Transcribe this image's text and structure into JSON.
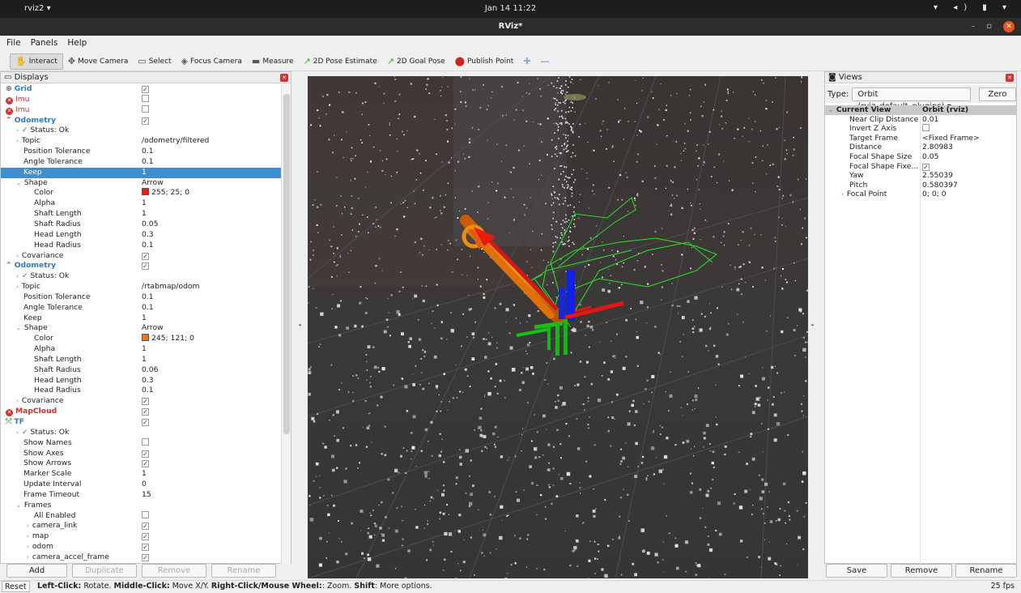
{
  "system_bar": {
    "app_label": "rviz2 ▾",
    "clock": "Jan 14  11:22",
    "tray": "▾ ◂) ▮ ▾"
  },
  "window": {
    "title": "RViz*"
  },
  "menu": [
    "File",
    "Panels",
    "Help"
  ],
  "toolbar": [
    {
      "label": "Interact",
      "icon": "✋",
      "active": true
    },
    {
      "label": "Move Camera",
      "icon": "✥"
    },
    {
      "label": "Select",
      "icon": "▭"
    },
    {
      "label": "Focus Camera",
      "icon": "◈"
    },
    {
      "label": "Measure",
      "icon": "▬"
    },
    {
      "label": "2D Pose Estimate",
      "icon": "↗"
    },
    {
      "label": "2D Goal Pose",
      "icon": "↗"
    },
    {
      "label": "Publish Point",
      "icon": "⬤"
    },
    {
      "label": "",
      "icon": "✛"
    },
    {
      "label": "",
      "icon": "—"
    }
  ],
  "displays": {
    "title": "Displays",
    "rows": [
      {
        "d": 0,
        "icon": "grid",
        "name": "Grid",
        "val": "",
        "chk": true,
        "style": "blue bold"
      },
      {
        "d": 0,
        "icon": "err",
        "name": "Imu",
        "val": "",
        "chk": false,
        "style": "red"
      },
      {
        "d": 0,
        "icon": "err",
        "name": "Imu",
        "val": "",
        "chk": false,
        "style": "red"
      },
      {
        "d": 0,
        "icon": "odom",
        "name": "Odometry",
        "val": "",
        "chk": true,
        "style": "blue bold"
      },
      {
        "d": 1,
        "arrow": "›",
        "ok": true,
        "name": "Status: Ok",
        "val": ""
      },
      {
        "d": 1,
        "arrow": "›",
        "name": "Topic",
        "val": "/odometry/filtered"
      },
      {
        "d": 1,
        "name": "Position Tolerance",
        "val": "0.1"
      },
      {
        "d": 1,
        "name": "Angle Tolerance",
        "val": "0.1"
      },
      {
        "d": 1,
        "name": "Keep",
        "val": "1",
        "selected": true
      },
      {
        "d": 1,
        "arrow": "⌄",
        "name": "Shape",
        "val": "Arrow"
      },
      {
        "d": 2,
        "name": "Color",
        "val": "255; 25; 0",
        "swatch": "#ff1900"
      },
      {
        "d": 2,
        "name": "Alpha",
        "val": "1"
      },
      {
        "d": 2,
        "name": "Shaft Length",
        "val": "1"
      },
      {
        "d": 2,
        "name": "Shaft Radius",
        "val": "0.05"
      },
      {
        "d": 2,
        "name": "Head Length",
        "val": "0.3"
      },
      {
        "d": 2,
        "name": "Head Radius",
        "val": "0.1"
      },
      {
        "d": 1,
        "arrow": "›",
        "name": "Covariance",
        "val": "",
        "chk": true
      },
      {
        "d": 0,
        "icon": "odom",
        "name": "Odometry",
        "val": "",
        "chk": true,
        "style": "blue bold"
      },
      {
        "d": 1,
        "arrow": "›",
        "ok": true,
        "name": "Status: Ok",
        "val": ""
      },
      {
        "d": 1,
        "arrow": "›",
        "name": "Topic",
        "val": "/rtabmap/odom"
      },
      {
        "d": 1,
        "name": "Position Tolerance",
        "val": "0.1"
      },
      {
        "d": 1,
        "name": "Angle Tolerance",
        "val": "0.1"
      },
      {
        "d": 1,
        "name": "Keep",
        "val": "1"
      },
      {
        "d": 1,
        "arrow": "⌄",
        "name": "Shape",
        "val": "Arrow"
      },
      {
        "d": 2,
        "name": "Color",
        "val": "245; 121; 0",
        "swatch": "#f57900"
      },
      {
        "d": 2,
        "name": "Alpha",
        "val": "1"
      },
      {
        "d": 2,
        "name": "Shaft Length",
        "val": "1"
      },
      {
        "d": 2,
        "name": "Shaft Radius",
        "val": "0.06"
      },
      {
        "d": 2,
        "name": "Head Length",
        "val": "0.3"
      },
      {
        "d": 2,
        "name": "Head Radius",
        "val": "0.1"
      },
      {
        "d": 1,
        "arrow": "›",
        "name": "Covariance",
        "val": "",
        "chk": true
      },
      {
        "d": 0,
        "icon": "err",
        "name": "MapCloud",
        "val": "",
        "chk": true,
        "style": "red bold"
      },
      {
        "d": 0,
        "icon": "tf",
        "name": "TF",
        "val": "",
        "chk": true,
        "style": "blue bold"
      },
      {
        "d": 1,
        "arrow": "›",
        "ok": true,
        "name": "Status: Ok",
        "val": ""
      },
      {
        "d": 1,
        "name": "Show Names",
        "val": "",
        "chk": false
      },
      {
        "d": 1,
        "name": "Show Axes",
        "val": "",
        "chk": true
      },
      {
        "d": 1,
        "name": "Show Arrows",
        "val": "",
        "chk": true
      },
      {
        "d": 1,
        "name": "Marker Scale",
        "val": "1"
      },
      {
        "d": 1,
        "name": "Update Interval",
        "val": "0"
      },
      {
        "d": 1,
        "name": "Frame Timeout",
        "val": "15"
      },
      {
        "d": 1,
        "arrow": "⌄",
        "name": "Frames",
        "val": ""
      },
      {
        "d": 2,
        "name": "All Enabled",
        "val": "",
        "chk": false
      },
      {
        "d": 2,
        "arrow": "›",
        "name": "camera_link",
        "val": "",
        "chk": true
      },
      {
        "d": 2,
        "arrow": "›",
        "name": "map",
        "val": "",
        "chk": true
      },
      {
        "d": 2,
        "arrow": "›",
        "name": "odom",
        "val": "",
        "chk": true
      },
      {
        "d": 2,
        "arrow": "›",
        "name": "camera_accel_frame",
        "val": "",
        "chk": true
      }
    ],
    "buttons": [
      "Add",
      "Duplicate",
      "Remove",
      "Rename"
    ]
  },
  "views": {
    "title": "Views",
    "type_label": "Type:",
    "type_value": "Orbit (rviz_default_plugins)",
    "zero_label": "Zero",
    "rows": [
      {
        "name": "Current View",
        "val": "Orbit (rviz)",
        "hdr": true
      },
      {
        "name": "Near Clip Distance",
        "val": "0.01"
      },
      {
        "name": "Invert Z Axis",
        "val": "",
        "chk": false
      },
      {
        "name": "Target Frame",
        "val": "<Fixed Frame>"
      },
      {
        "name": "Distance",
        "val": "2.80983"
      },
      {
        "name": "Focal Shape Size",
        "val": "0.05"
      },
      {
        "name": "Focal Shape Fixe...",
        "val": "",
        "chk": true
      },
      {
        "name": "Yaw",
        "val": "2.55039"
      },
      {
        "name": "Pitch",
        "val": "0.580397"
      },
      {
        "name": "Focal Point",
        "val": "0; 0; 0",
        "arrow": true
      }
    ],
    "buttons": [
      "Save",
      "Remove",
      "Rename"
    ]
  },
  "status": {
    "reset": "Reset",
    "message_html": "<b>Left-Click:</b> Rotate. <b>Middle-Click:</b> Move X/Y. <b>Right-Click/Mouse Wheel:</b>: Zoom. <b>Shift</b>: More options.",
    "fps": "25 fps"
  },
  "colors": {
    "odometry1": "#ff1900",
    "odometry2": "#f57900",
    "selection": "#3d8fd1",
    "error": "#cf3131"
  }
}
